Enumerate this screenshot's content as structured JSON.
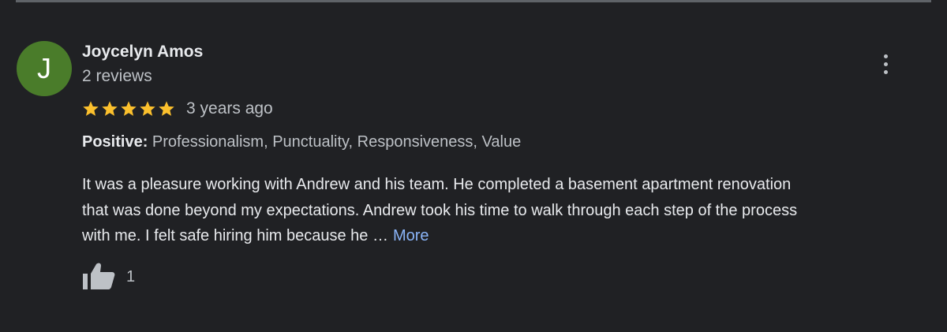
{
  "review": {
    "author": {
      "initial": "J",
      "name": "Joycelyn Amos",
      "review_count": "2 reviews",
      "avatar_color": "#4a7c2a"
    },
    "rating": 5,
    "rating_max": 5,
    "star_color": "#fbc02d",
    "time_ago": "3 years ago",
    "positive": {
      "label": "Positive:",
      "value": "Professionalism, Punctuality, Responsiveness, Value"
    },
    "text_lines": [
      "It was a pleasure working with Andrew and his team. He completed a basement apartment renovation",
      "that was done beyond my expectations. Andrew took his time to walk through each step of the process",
      "with me. I felt safe hiring him because he …"
    ],
    "more_link": "More",
    "link_color": "#8ab4f8",
    "likes": "1",
    "icons": {
      "menu": "more-vert-icon",
      "like": "thumbs-up-icon",
      "star": "star-icon"
    }
  }
}
